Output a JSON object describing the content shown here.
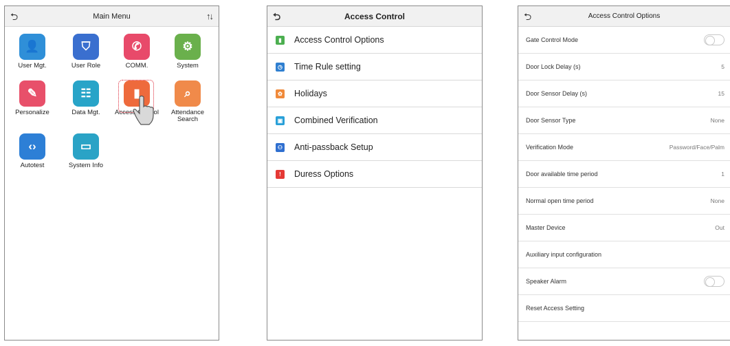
{
  "main_menu": {
    "title": "Main Menu",
    "items": [
      {
        "label": "User Mgt.",
        "icon": "user-icon",
        "color": "#2f8fd8"
      },
      {
        "label": "User Role",
        "icon": "shield-icon",
        "color": "#3a6fcf"
      },
      {
        "label": "COMM.",
        "icon": "satellite-dish-icon",
        "color": "#e84a6a"
      },
      {
        "label": "System",
        "icon": "gear-icon",
        "color": "#6ab04c"
      },
      {
        "label": "Personalize",
        "icon": "palette-icon",
        "color": "#e8506a"
      },
      {
        "label": "Data Mgt.",
        "icon": "database-icon",
        "color": "#28a4c8"
      },
      {
        "label": "Access Control",
        "icon": "door-icon",
        "color": "#ee6a3c"
      },
      {
        "label": "Attendance Search",
        "icon": "search-document-icon",
        "color": "#f08a4a"
      },
      {
        "label": "Autotest",
        "icon": "code-icon",
        "color": "#2d7fd6"
      },
      {
        "label": "System Info",
        "icon": "monitor-icon",
        "color": "#2aa3c6"
      }
    ]
  },
  "access_control": {
    "title": "Access Control",
    "items": [
      {
        "label": "Access Control Options",
        "icon": "door-icon",
        "color": "#4caf50"
      },
      {
        "label": "Time Rule setting",
        "icon": "clock-icon",
        "color": "#2f7fd0"
      },
      {
        "label": "Holidays",
        "icon": "holiday-icon",
        "color": "#f08a3a"
      },
      {
        "label": "Combined Verification",
        "icon": "lock-icon",
        "color": "#29a0d8"
      },
      {
        "label": "Anti-passback Setup",
        "icon": "people-icon",
        "color": "#2f6fd0"
      },
      {
        "label": "Duress Options",
        "icon": "warning-icon",
        "color": "#e53935"
      }
    ]
  },
  "options": {
    "title": "Access Control Options",
    "rows": [
      {
        "label": "Gate Control Mode",
        "value": "",
        "toggle": true
      },
      {
        "label": "Door Lock Delay (s)",
        "value": "5",
        "toggle": false
      },
      {
        "label": "Door Sensor Delay (s)",
        "value": "15",
        "toggle": false
      },
      {
        "label": "Door Sensor Type",
        "value": "None",
        "toggle": false
      },
      {
        "label": "Verification Mode",
        "value": "Password/Face/Palm",
        "toggle": false
      },
      {
        "label": "Door available time period",
        "value": "1",
        "toggle": false
      },
      {
        "label": "Normal open time period",
        "value": "None",
        "toggle": false
      },
      {
        "label": "Master Device",
        "value": "Out",
        "toggle": false
      },
      {
        "label": "Auxiliary input configuration",
        "value": "",
        "toggle": false
      },
      {
        "label": "Speaker Alarm",
        "value": "",
        "toggle": true
      },
      {
        "label": "Reset Access Setting",
        "value": "",
        "toggle": false
      }
    ]
  }
}
